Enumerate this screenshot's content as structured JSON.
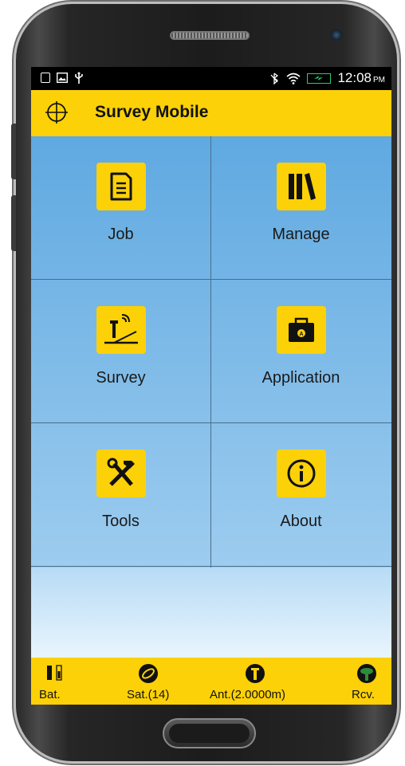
{
  "status_bar": {
    "time": "12:08",
    "ampm": "PM",
    "icons_left": [
      "notification-icon",
      "image-icon",
      "usb-icon"
    ],
    "icons_right": [
      "mute-icon",
      "wifi-icon",
      "battery-charging-icon"
    ]
  },
  "app_bar": {
    "title": "Survey Mobile",
    "logo_icon": "crosshair-icon"
  },
  "menu": {
    "items": [
      {
        "label": "Job",
        "icon": "document-icon"
      },
      {
        "label": "Manage",
        "icon": "library-books-icon"
      },
      {
        "label": "Survey",
        "icon": "gnss-survey-pole-icon"
      },
      {
        "label": "Application",
        "icon": "toolbox-icon"
      },
      {
        "label": "Tools",
        "icon": "hammer-wrench-icon"
      },
      {
        "label": "About",
        "icon": "info-icon"
      }
    ]
  },
  "bottom_bar": {
    "items": [
      {
        "label": "Bat.",
        "icon": "battery-icon"
      },
      {
        "label": "Sat.(14)",
        "icon": "satellite-icon"
      },
      {
        "label": "Ant.(2.0000m)",
        "icon": "antenna-icon"
      },
      {
        "label": "Rcv.",
        "icon": "receiver-icon"
      }
    ]
  },
  "colors": {
    "accent": "#fcd107",
    "tile_gradient_top": "#5fa9e1",
    "tile_gradient_bottom": "#9dccef",
    "receiver_green": "#2e8b3a"
  }
}
